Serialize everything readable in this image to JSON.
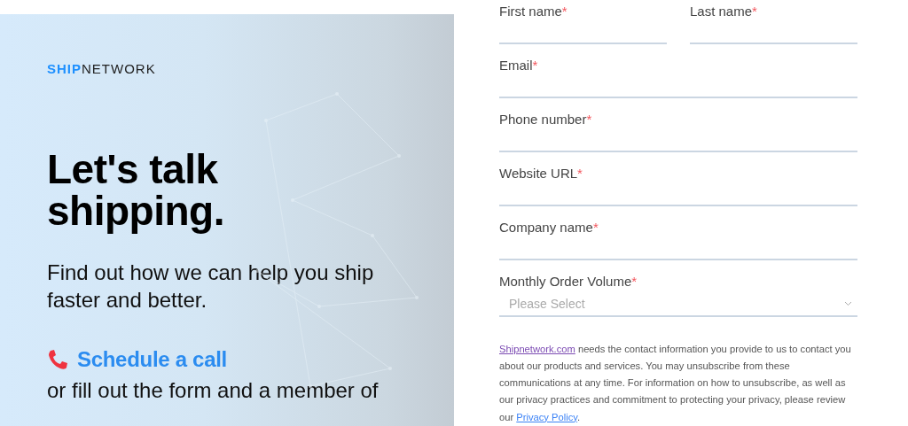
{
  "brand": {
    "strong": "SHIP",
    "light": "NETWORK"
  },
  "hero": {
    "heading": [
      "Let's talk",
      "shipping."
    ],
    "subtitle": "Find out how we can help you ship faster and better.",
    "cta": "Schedule a call",
    "follow": "or fill out the form and a member of"
  },
  "form": {
    "rows": [
      [
        {
          "kind": "text",
          "label": "First name",
          "mark": "*"
        },
        {
          "kind": "text",
          "label": "Last name",
          "mark": "*"
        }
      ],
      [
        {
          "kind": "text",
          "label": "Email",
          "mark": "*"
        }
      ],
      [
        {
          "kind": "text",
          "label": "Phone number",
          "mark": "*"
        }
      ],
      [
        {
          "kind": "text",
          "label": "Website URL",
          "mark": "*"
        }
      ],
      [
        {
          "kind": "text",
          "label": "Company name",
          "mark": "*"
        }
      ],
      [
        {
          "kind": "select",
          "label": "Monthly Order Volume",
          "mark": "*",
          "placeholder": "Please Select"
        }
      ]
    ],
    "disclaimer": [
      {
        "kind": "link",
        "text": "Shipnetwork.com",
        "visited": true
      },
      {
        "kind": "text",
        "text": " needs the contact information you provide to us to contact you about our products and services. You may unsubscribe from these communications at any time. For information on how to unsubscribe, as well as our privacy practices and commitment to protecting your privacy, please review our "
      },
      {
        "kind": "link",
        "text": "Privacy Policy",
        "visited": false
      },
      {
        "kind": "text",
        "text": "."
      }
    ]
  }
}
